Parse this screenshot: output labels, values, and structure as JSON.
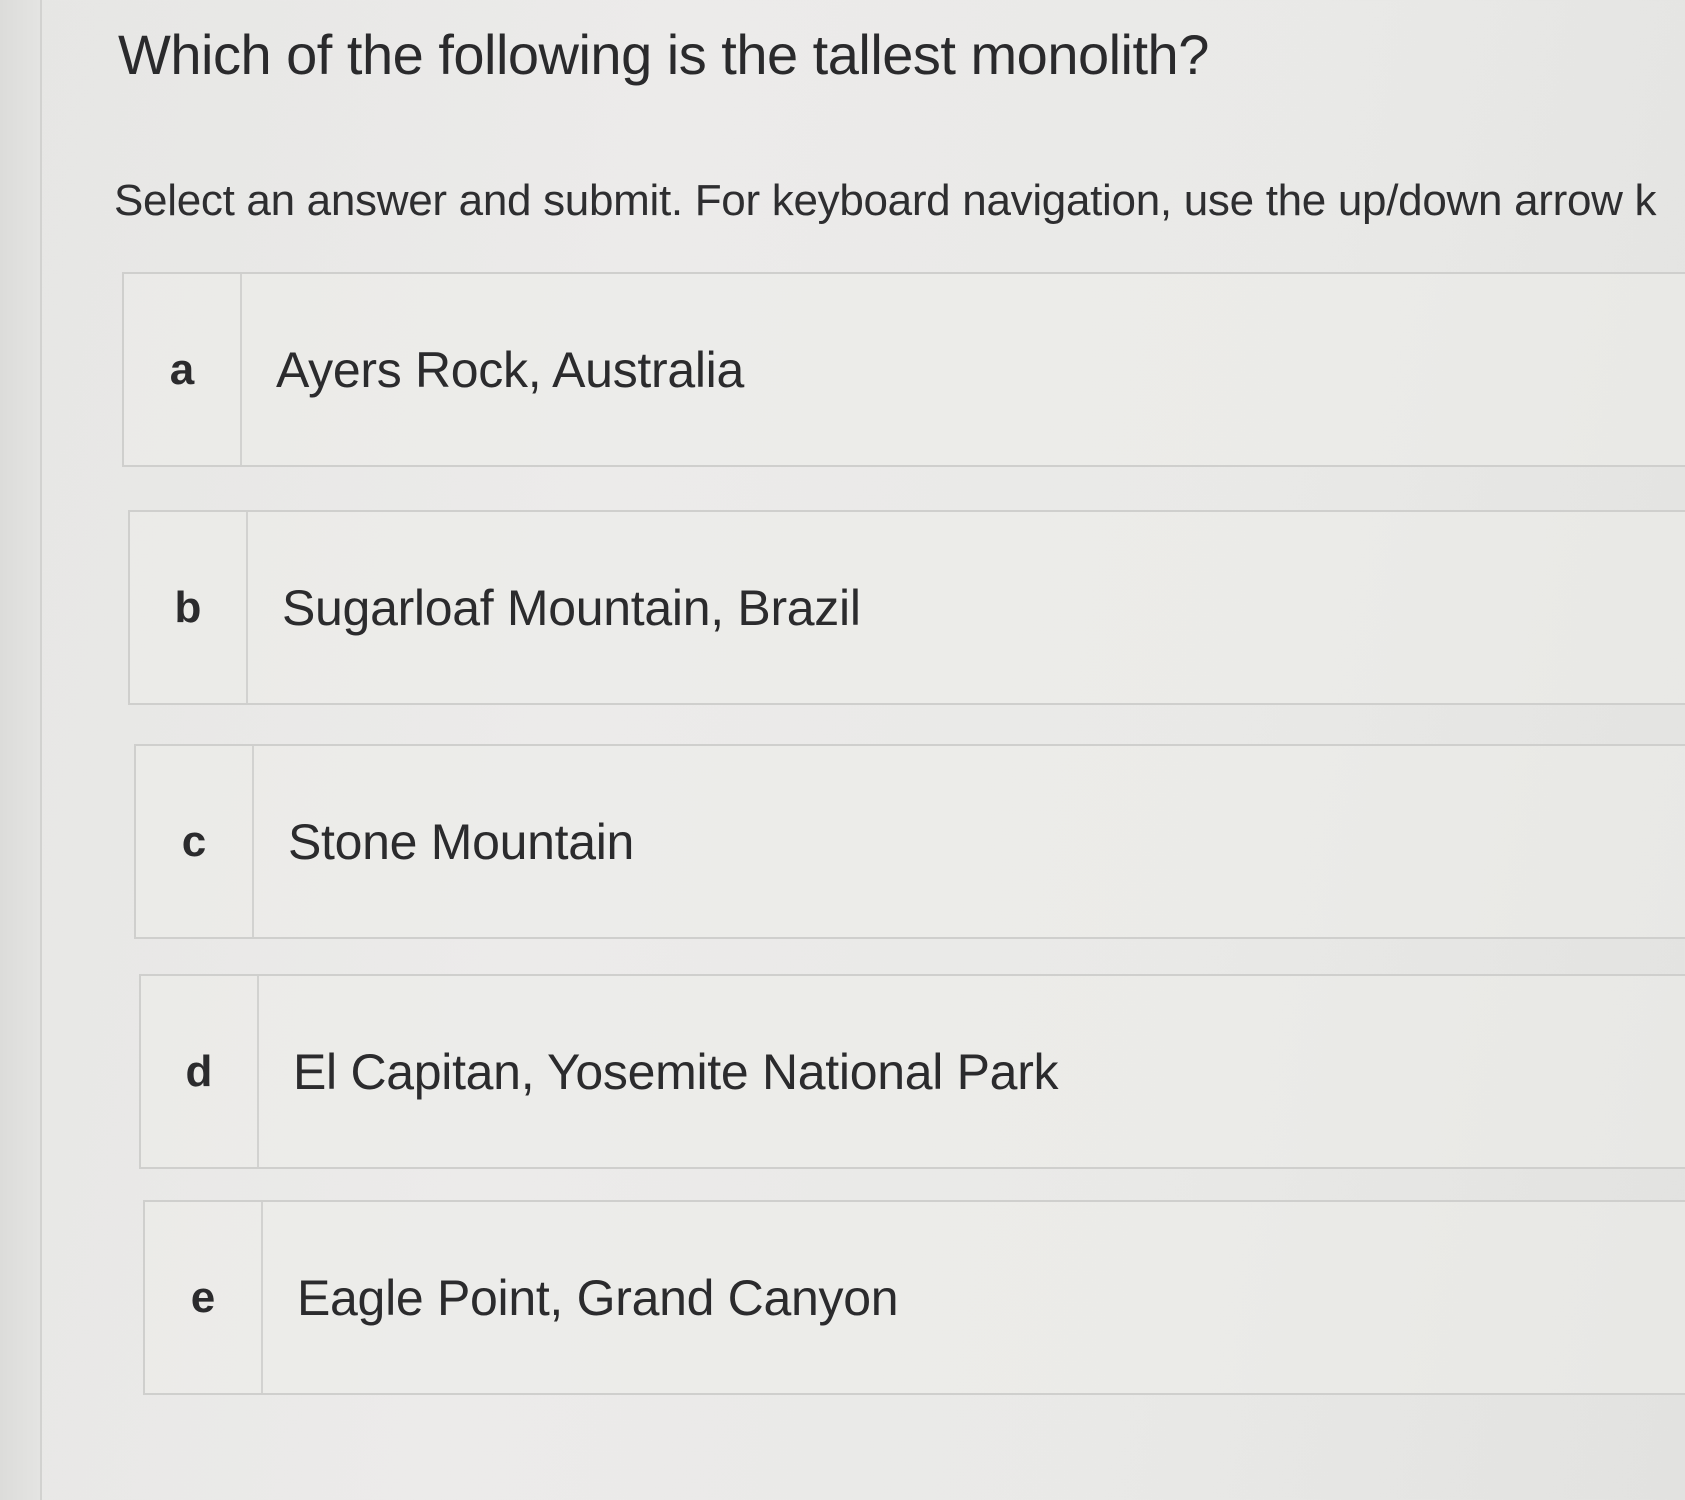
{
  "question": {
    "text": "Which of the following is the tallest monolith?"
  },
  "instructions": {
    "text": "Select an answer and submit. For keyboard navigation, use the up/down arrow k"
  },
  "options": [
    {
      "letter": "a",
      "text": "Ayers Rock, Australia"
    },
    {
      "letter": "b",
      "text": "Sugarloaf Mountain, Brazil"
    },
    {
      "letter": "c",
      "text": "Stone Mountain"
    },
    {
      "letter": "d",
      "text": "El Capitan, Yosemite National Park"
    },
    {
      "letter": "e",
      "text": "Eagle Point, Grand Canyon"
    }
  ]
}
